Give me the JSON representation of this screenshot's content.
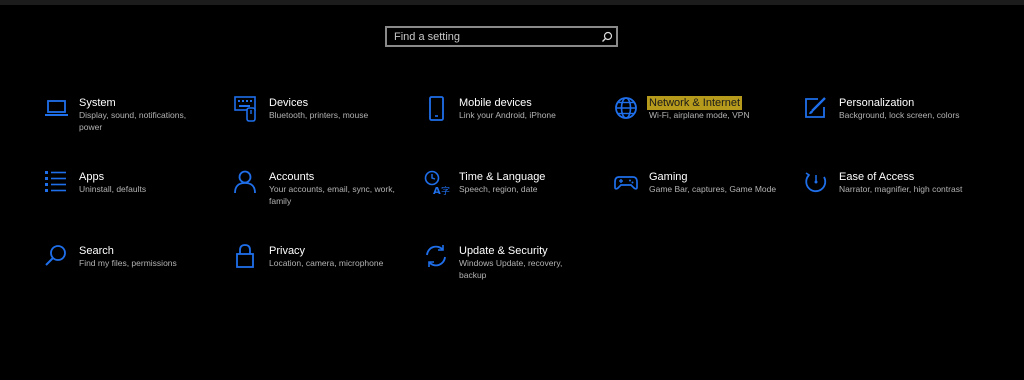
{
  "search": {
    "placeholder": "Find a setting",
    "icon": "search-icon"
  },
  "accent_color": "#1f6feb",
  "highlight_color": "#b59a1c",
  "tiles": [
    {
      "key": "system",
      "icon": "laptop-icon",
      "title": "System",
      "desc": "Display, sound, notifications, power"
    },
    {
      "key": "devices",
      "icon": "keyboard-icon",
      "title": "Devices",
      "desc": "Bluetooth, printers, mouse"
    },
    {
      "key": "mobile",
      "icon": "phone-icon",
      "title": "Mobile devices",
      "desc": "Link your Android, iPhone"
    },
    {
      "key": "network",
      "icon": "globe-icon",
      "title": "Network & Internet",
      "desc": "Wi-Fi, airplane mode, VPN",
      "highlighted": true
    },
    {
      "key": "personalization",
      "icon": "paint-brush-icon",
      "title": "Personalization",
      "desc": "Background, lock screen, colors"
    },
    {
      "key": "apps",
      "icon": "apps-list-icon",
      "title": "Apps",
      "desc": "Uninstall, defaults"
    },
    {
      "key": "accounts",
      "icon": "person-icon",
      "title": "Accounts",
      "desc": "Your accounts, email, sync, work, family"
    },
    {
      "key": "time",
      "icon": "time-language-icon",
      "title": "Time & Language",
      "desc": "Speech, region, date"
    },
    {
      "key": "gaming",
      "icon": "gamepad-icon",
      "title": "Gaming",
      "desc": "Game Bar, captures, Game Mode"
    },
    {
      "key": "ease",
      "icon": "ease-of-access-icon",
      "title": "Ease of Access",
      "desc": "Narrator, magnifier, high contrast"
    },
    {
      "key": "search",
      "icon": "magnifier-icon",
      "title": "Search",
      "desc": "Find my files, permissions"
    },
    {
      "key": "privacy",
      "icon": "lock-icon",
      "title": "Privacy",
      "desc": "Location, camera, microphone"
    },
    {
      "key": "update",
      "icon": "sync-icon",
      "title": "Update & Security",
      "desc": "Windows Update, recovery, backup"
    }
  ]
}
